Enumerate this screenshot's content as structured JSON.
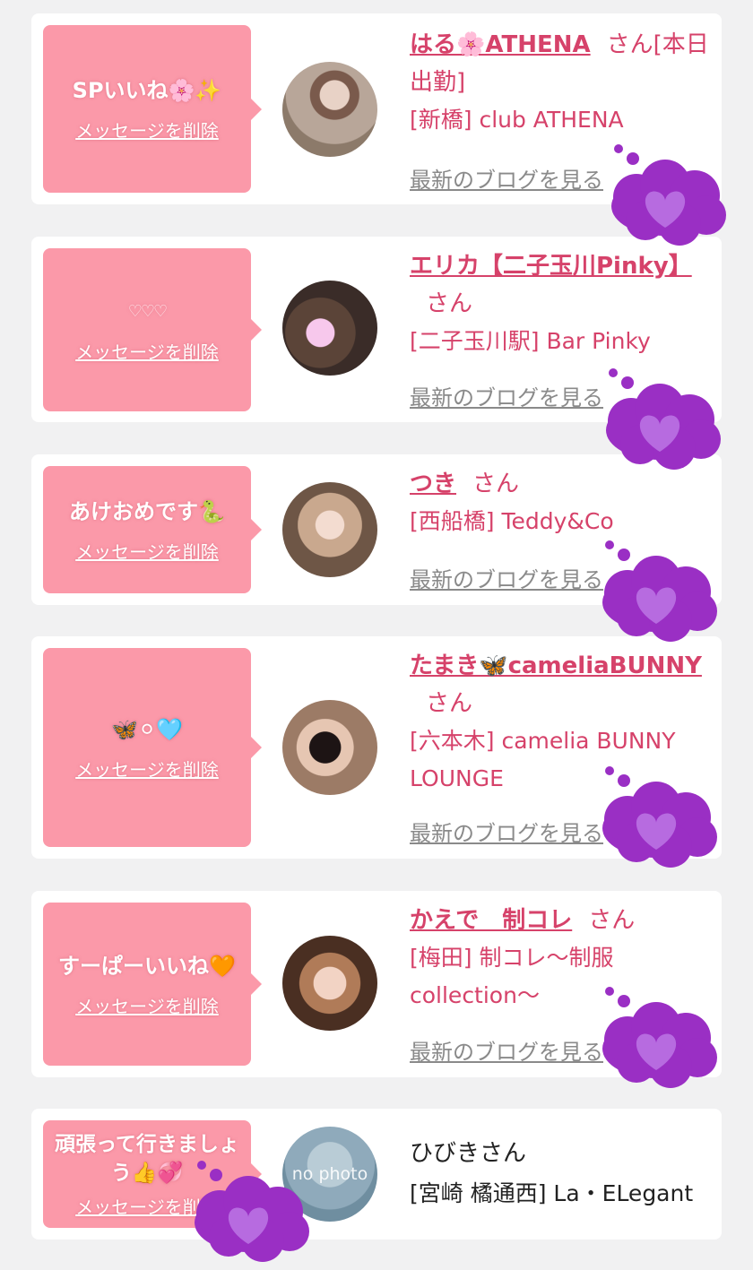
{
  "entries": [
    {
      "message": "SPいいね🌸✨",
      "delete_label": "メッセージを削除",
      "name": "はる🌸ATHENA",
      "san_suffix": "さん[本日出勤]",
      "shop": "[新橋] club ATHENA",
      "blog_label": "最新のブログを見る"
    },
    {
      "message": "♡♡♡",
      "delete_label": "メッセージを削除",
      "name": "エリカ【二子玉川Pinky】",
      "san_suffix": "さん",
      "shop": "[二子玉川駅] Bar Pinky",
      "blog_label": "最新のブログを見る"
    },
    {
      "message": "あけおめです🐍",
      "delete_label": "メッセージを削除",
      "name": "つき",
      "san_suffix": "さん",
      "shop": "[西船橋] Teddy&Co",
      "blog_label": "最新のブログを見る"
    },
    {
      "message": "🦋⚪︎🩵",
      "delete_label": "メッセージを削除",
      "name": "たまき🦋cameliaBUNNY",
      "san_suffix": "さん",
      "shop": "[六本木] camelia BUNNY LOUNGE",
      "blog_label": "最新のブログを見る"
    },
    {
      "message": "すーぱーいいね🧡",
      "delete_label": "メッセージを削除",
      "name": "かえで　制コレ",
      "san_suffix": "さん",
      "shop": "[梅田] 制コレ〜制服collection〜",
      "blog_label": "最新のブログを見る"
    },
    {
      "message": "頑張って行きましょう👍💞",
      "delete_label": "メッセージを削除",
      "name": "ひびきさん",
      "shop": "[宮崎 橘通西] La・ELegant",
      "avatar_text": "no photo"
    }
  ],
  "colors": {
    "page_bg": "#f1f1f2",
    "bubble": "#fb99a9",
    "accent": "#d6426a",
    "cloud": "#9a2fc4",
    "heart": "#b76be0"
  },
  "icons": [
    "thought-cloud-heart-icon"
  ]
}
